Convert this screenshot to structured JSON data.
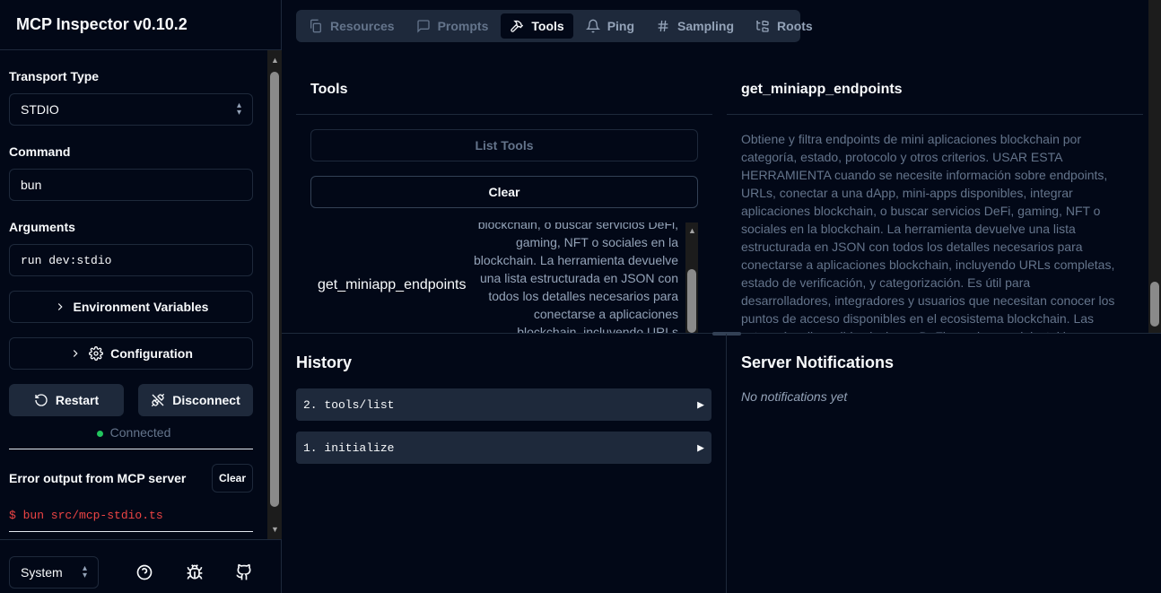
{
  "app": {
    "title": "MCP Inspector v0.10.2"
  },
  "sidebar": {
    "transport_label": "Transport Type",
    "transport_value": "STDIO",
    "command_label": "Command",
    "command_value": "bun",
    "arguments_label": "Arguments",
    "arguments_value": "run dev:stdio",
    "env_label": "Environment Variables",
    "config_label": "Configuration",
    "restart_label": "Restart",
    "disconnect_label": "Disconnect",
    "status_text": "Connected",
    "error_title": "Error output from MCP server",
    "error_clear_label": "Clear",
    "error_line": "$ bun src/mcp-stdio.ts",
    "theme_value": "System"
  },
  "tabs": [
    {
      "label": "Resources",
      "icon": "files-icon"
    },
    {
      "label": "Prompts",
      "icon": "message-square-icon"
    },
    {
      "label": "Tools",
      "icon": "hammer-icon"
    },
    {
      "label": "Ping",
      "icon": "bell-icon"
    },
    {
      "label": "Sampling",
      "icon": "hash-icon"
    },
    {
      "label": "Roots",
      "icon": "folder-tree-icon"
    }
  ],
  "tools_panel": {
    "title": "Tools",
    "list_label": "List Tools",
    "clear_label": "Clear",
    "item_name": "get_miniapp_endpoints",
    "item_desc": "blockchain, o buscar servicios DeFi, gaming, NFT o sociales en la blockchain. La herramienta devuelve una lista estructurada en JSON con todos los detalles necesarios para conectarse a aplicaciones blockchain, incluyendo URLs completas, estado"
  },
  "detail_panel": {
    "title": "get_miniapp_endpoints",
    "description": "Obtiene y filtra endpoints de mini aplicaciones blockchain por categoría, estado, protocolo y otros criterios. USAR ESTA HERRAMIENTA cuando se necesite información sobre endpoints, URLs, conectar a una dApp, mini-apps disponibles, integrar aplicaciones blockchain, o buscar servicios DeFi, gaming, NFT o sociales en la blockchain. La herramienta devuelve una lista estructurada en JSON con todos los detalles necesarios para conectarse a aplicaciones blockchain, incluyendo URLs completas, estado de verificación, y categorización. Es útil para desarrolladores, integradores y usuarios que necesitan conocer los puntos de acceso disponibles en el ecosistema blockchain. Las categorías disponibles incluyen DeFi, gaming, social, staking y Casino NFT."
  },
  "history": {
    "title": "History",
    "items": [
      "2. tools/list",
      "1. initialize"
    ]
  },
  "notifications": {
    "title": "Server Notifications",
    "empty": "No notifications yet"
  }
}
